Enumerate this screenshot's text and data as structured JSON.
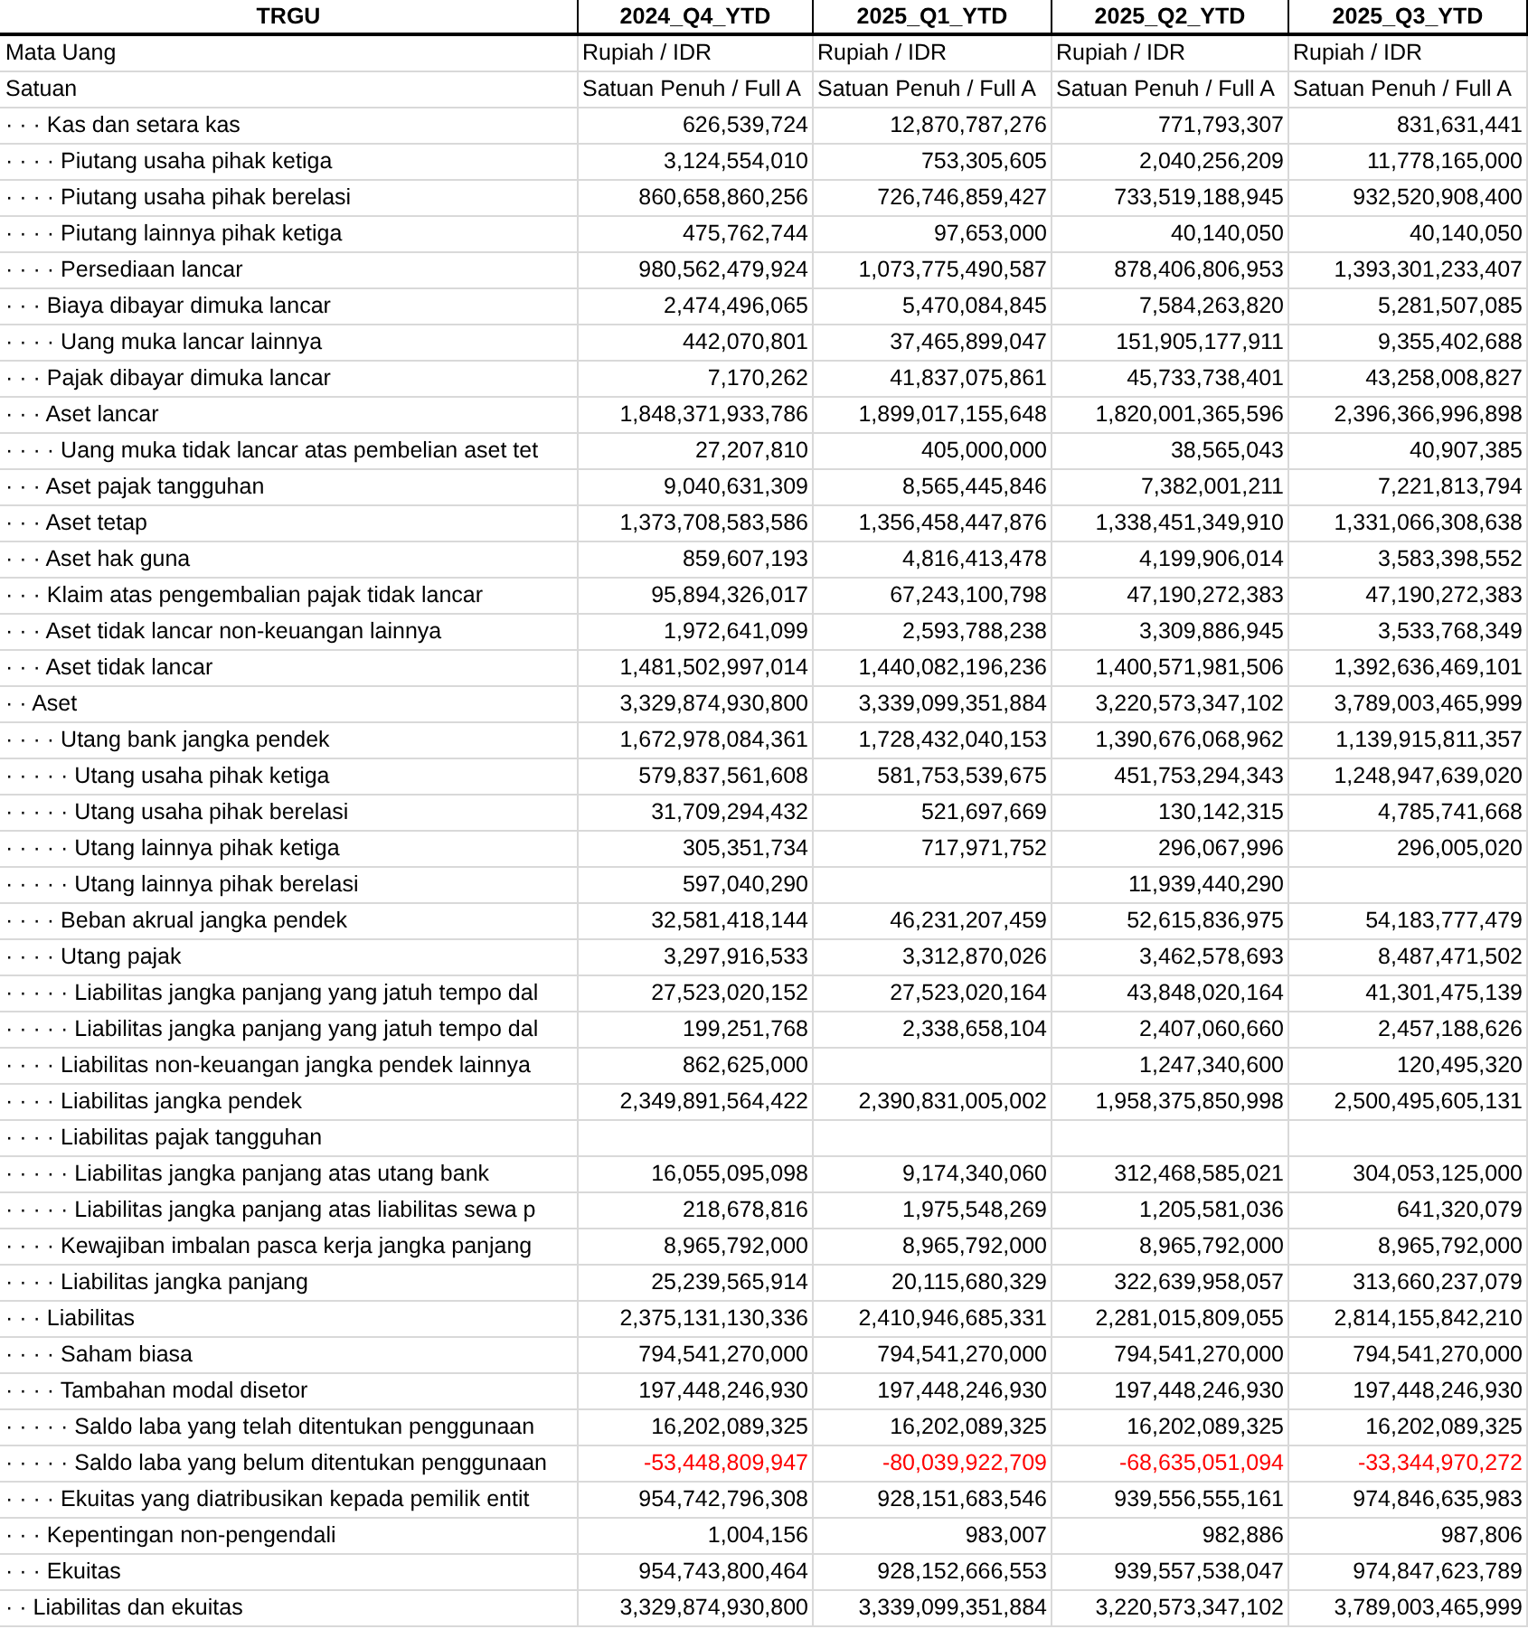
{
  "table": {
    "title": "TRGU",
    "columns": [
      "2024_Q4_YTD",
      "2025_Q1_YTD",
      "2025_Q2_YTD",
      "2025_Q3_YTD"
    ],
    "rows": [
      {
        "label": "Mata Uang",
        "kind": "text",
        "q4_2024": "Rupiah / IDR",
        "q1_2025": "Rupiah / IDR",
        "q2_2025": "Rupiah / IDR",
        "q3_2025": "Rupiah / IDR"
      },
      {
        "label": "Satuan",
        "kind": "text",
        "q4_2024": "Satuan Penuh / Full A",
        "q1_2025": "Satuan Penuh / Full A",
        "q2_2025": "Satuan Penuh / Full A",
        "q3_2025": "Satuan Penuh / Full A"
      },
      {
        "label": "· · · Kas dan setara kas",
        "kind": "amount",
        "q4_2024": "626,539,724",
        "q1_2025": "12,870,787,276",
        "q2_2025": "771,793,307",
        "q3_2025": "831,631,441"
      },
      {
        "label": "· · · · Piutang usaha pihak ketiga",
        "kind": "amount",
        "q4_2024": "3,124,554,010",
        "q1_2025": "753,305,605",
        "q2_2025": "2,040,256,209",
        "q3_2025": "11,778,165,000"
      },
      {
        "label": "· · · · Piutang usaha pihak berelasi",
        "kind": "amount",
        "q4_2024": "860,658,860,256",
        "q1_2025": "726,746,859,427",
        "q2_2025": "733,519,188,945",
        "q3_2025": "932,520,908,400"
      },
      {
        "label": "· · · · Piutang lainnya pihak ketiga",
        "kind": "amount",
        "q4_2024": "475,762,744",
        "q1_2025": "97,653,000",
        "q2_2025": "40,140,050",
        "q3_2025": "40,140,050"
      },
      {
        "label": "· · · · Persediaan lancar",
        "kind": "amount",
        "q4_2024": "980,562,479,924",
        "q1_2025": "1,073,775,490,587",
        "q2_2025": "878,406,806,953",
        "q3_2025": "1,393,301,233,407"
      },
      {
        "label": "· · · Biaya dibayar dimuka lancar",
        "kind": "amount",
        "q4_2024": "2,474,496,065",
        "q1_2025": "5,470,084,845",
        "q2_2025": "7,584,263,820",
        "q3_2025": "5,281,507,085"
      },
      {
        "label": "· · · · Uang muka lancar lainnya",
        "kind": "amount",
        "q4_2024": "442,070,801",
        "q1_2025": "37,465,899,047",
        "q2_2025": "151,905,177,911",
        "q3_2025": "9,355,402,688"
      },
      {
        "label": "· · · Pajak dibayar dimuka lancar",
        "kind": "amount",
        "q4_2024": "7,170,262",
        "q1_2025": "41,837,075,861",
        "q2_2025": "45,733,738,401",
        "q3_2025": "43,258,008,827"
      },
      {
        "label": "· · · Aset lancar",
        "kind": "amount",
        "q4_2024": "1,848,371,933,786",
        "q1_2025": "1,899,017,155,648",
        "q2_2025": "1,820,001,365,596",
        "q3_2025": "2,396,366,996,898"
      },
      {
        "label": "· · · · Uang muka tidak lancar atas pembelian aset tet",
        "kind": "amount",
        "q4_2024": "27,207,810",
        "q1_2025": "405,000,000",
        "q2_2025": "38,565,043",
        "q3_2025": "40,907,385"
      },
      {
        "label": "· · · Aset pajak tangguhan",
        "kind": "amount",
        "q4_2024": "9,040,631,309",
        "q1_2025": "8,565,445,846",
        "q2_2025": "7,382,001,211",
        "q3_2025": "7,221,813,794"
      },
      {
        "label": "· · · Aset tetap",
        "kind": "amount",
        "q4_2024": "1,373,708,583,586",
        "q1_2025": "1,356,458,447,876",
        "q2_2025": "1,338,451,349,910",
        "q3_2025": "1,331,066,308,638"
      },
      {
        "label": "· · · Aset hak guna",
        "kind": "amount",
        "q4_2024": "859,607,193",
        "q1_2025": "4,816,413,478",
        "q2_2025": "4,199,906,014",
        "q3_2025": "3,583,398,552"
      },
      {
        "label": "· · · Klaim atas pengembalian pajak tidak lancar",
        "kind": "amount",
        "q4_2024": "95,894,326,017",
        "q1_2025": "67,243,100,798",
        "q2_2025": "47,190,272,383",
        "q3_2025": "47,190,272,383"
      },
      {
        "label": "· · · Aset tidak lancar non-keuangan lainnya",
        "kind": "amount",
        "q4_2024": "1,972,641,099",
        "q1_2025": "2,593,788,238",
        "q2_2025": "3,309,886,945",
        "q3_2025": "3,533,768,349"
      },
      {
        "label": "· · · Aset tidak lancar",
        "kind": "amount",
        "q4_2024": "1,481,502,997,014",
        "q1_2025": "1,440,082,196,236",
        "q2_2025": "1,400,571,981,506",
        "q3_2025": "1,392,636,469,101"
      },
      {
        "label": "· · Aset",
        "kind": "amount",
        "q4_2024": "3,329,874,930,800",
        "q1_2025": "3,339,099,351,884",
        "q2_2025": "3,220,573,347,102",
        "q3_2025": "3,789,003,465,999"
      },
      {
        "label": "· · · · Utang bank jangka pendek",
        "kind": "amount",
        "q4_2024": "1,672,978,084,361",
        "q1_2025": "1,728,432,040,153",
        "q2_2025": "1,390,676,068,962",
        "q3_2025": "1,139,915,811,357"
      },
      {
        "label": "· · · · · Utang usaha pihak ketiga",
        "kind": "amount",
        "q4_2024": "579,837,561,608",
        "q1_2025": "581,753,539,675",
        "q2_2025": "451,753,294,343",
        "q3_2025": "1,248,947,639,020"
      },
      {
        "label": "· · · · · Utang usaha pihak berelasi",
        "kind": "amount",
        "q4_2024": "31,709,294,432",
        "q1_2025": "521,697,669",
        "q2_2025": "130,142,315",
        "q3_2025": "4,785,741,668"
      },
      {
        "label": "· · · · · Utang lainnya pihak ketiga",
        "kind": "amount",
        "q4_2024": "305,351,734",
        "q1_2025": "717,971,752",
        "q2_2025": "296,067,996",
        "q3_2025": "296,005,020"
      },
      {
        "label": "· · · · · Utang lainnya pihak berelasi",
        "kind": "amount",
        "q4_2024": "597,040,290",
        "q2_2025": "11,939,440,290"
      },
      {
        "label": "· · · · Beban akrual jangka pendek",
        "kind": "amount",
        "q4_2024": "32,581,418,144",
        "q1_2025": "46,231,207,459",
        "q2_2025": "52,615,836,975",
        "q3_2025": "54,183,777,479"
      },
      {
        "label": "· · · · Utang pajak",
        "kind": "amount",
        "q4_2024": "3,297,916,533",
        "q1_2025": "3,312,870,026",
        "q2_2025": "3,462,578,693",
        "q3_2025": "8,487,471,502"
      },
      {
        "label": "· · · · · Liabilitas jangka panjang yang jatuh tempo dal",
        "kind": "amount",
        "q4_2024": "27,523,020,152",
        "q1_2025": "27,523,020,164",
        "q2_2025": "43,848,020,164",
        "q3_2025": "41,301,475,139"
      },
      {
        "label": "· · · · · Liabilitas jangka panjang yang jatuh tempo dal",
        "kind": "amount",
        "q4_2024": "199,251,768",
        "q1_2025": "2,338,658,104",
        "q2_2025": "2,407,060,660",
        "q3_2025": "2,457,188,626"
      },
      {
        "label": "· · · · Liabilitas non-keuangan jangka pendek lainnya",
        "kind": "amount",
        "q4_2024": "862,625,000",
        "q2_2025": "1,247,340,600",
        "q3_2025": "120,495,320"
      },
      {
        "label": "· · · · Liabilitas jangka pendek",
        "kind": "amount",
        "q4_2024": "2,349,891,564,422",
        "q1_2025": "2,390,831,005,002",
        "q2_2025": "1,958,375,850,998",
        "q3_2025": "2,500,495,605,131"
      },
      {
        "label": "· · · · Liabilitas pajak tangguhan",
        "kind": "amount"
      },
      {
        "label": "· · · · · Liabilitas jangka panjang atas utang bank",
        "kind": "amount",
        "q4_2024": "16,055,095,098",
        "q1_2025": "9,174,340,060",
        "q2_2025": "312,468,585,021",
        "q3_2025": "304,053,125,000"
      },
      {
        "label": "· · · · · Liabilitas jangka panjang atas liabilitas sewa p",
        "kind": "amount",
        "q4_2024": "218,678,816",
        "q1_2025": "1,975,548,269",
        "q2_2025": "1,205,581,036",
        "q3_2025": "641,320,079"
      },
      {
        "label": "· · · · Kewajiban imbalan pasca kerja jangka panjang",
        "kind": "amount",
        "q4_2024": "8,965,792,000",
        "q1_2025": "8,965,792,000",
        "q2_2025": "8,965,792,000",
        "q3_2025": "8,965,792,000"
      },
      {
        "label": "· · · · Liabilitas jangka panjang",
        "kind": "amount",
        "q4_2024": "25,239,565,914",
        "q1_2025": "20,115,680,329",
        "q2_2025": "322,639,958,057",
        "q3_2025": "313,660,237,079"
      },
      {
        "label": "· · · Liabilitas",
        "kind": "amount",
        "q4_2024": "2,375,131,130,336",
        "q1_2025": "2,410,946,685,331",
        "q2_2025": "2,281,015,809,055",
        "q3_2025": "2,814,155,842,210"
      },
      {
        "label": "· · · · Saham biasa",
        "kind": "amount",
        "q4_2024": "794,541,270,000",
        "q1_2025": "794,541,270,000",
        "q2_2025": "794,541,270,000",
        "q3_2025": "794,541,270,000"
      },
      {
        "label": "· · · · Tambahan modal disetor",
        "kind": "amount",
        "q4_2024": "197,448,246,930",
        "q1_2025": "197,448,246,930",
        "q2_2025": "197,448,246,930",
        "q3_2025": "197,448,246,930"
      },
      {
        "label": "· · · · · Saldo laba yang telah ditentukan penggunaan",
        "kind": "amount",
        "q4_2024": "16,202,089,325",
        "q1_2025": "16,202,089,325",
        "q2_2025": "16,202,089,325",
        "q3_2025": "16,202,089,325"
      },
      {
        "label": "· · · · · Saldo laba yang belum ditentukan penggunaan",
        "kind": "negative",
        "q4_2024": "-53,448,809,947",
        "q1_2025": "-80,039,922,709",
        "q2_2025": "-68,635,051,094",
        "q3_2025": "-33,344,970,272"
      },
      {
        "label": "· · · · Ekuitas yang diatribusikan kepada pemilik entit",
        "kind": "amount",
        "q4_2024": "954,742,796,308",
        "q1_2025": "928,151,683,546",
        "q2_2025": "939,556,555,161",
        "q3_2025": "974,846,635,983"
      },
      {
        "label": "· · · Kepentingan non-pengendali",
        "kind": "amount",
        "q4_2024": "1,004,156",
        "q1_2025": "983,007",
        "q2_2025": "982,886",
        "q3_2025": "987,806"
      },
      {
        "label": "· · · Ekuitas",
        "kind": "amount",
        "q4_2024": "954,743,800,464",
        "q1_2025": "928,152,666,553",
        "q2_2025": "939,557,538,047",
        "q3_2025": "974,847,623,789"
      },
      {
        "label": "· · Liabilitas dan ekuitas",
        "kind": "amount",
        "q4_2024": "3,329,874,930,800",
        "q1_2025": "3,339,099,351,884",
        "q2_2025": "3,220,573,347,102",
        "q3_2025": "3,789,003,465,999"
      }
    ]
  }
}
